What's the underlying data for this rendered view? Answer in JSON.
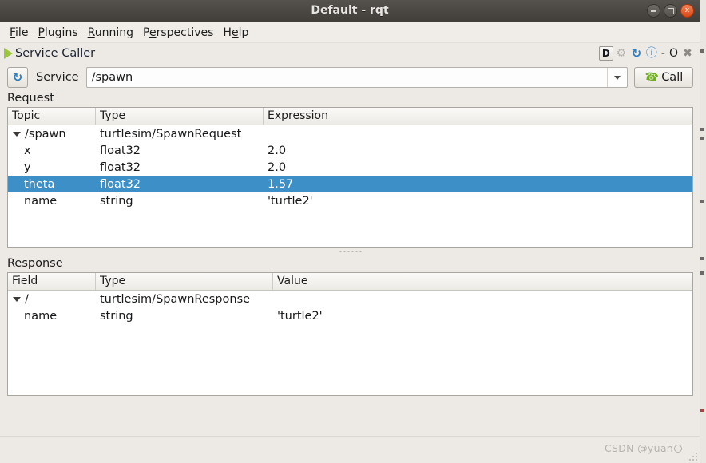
{
  "window": {
    "title": "Default - rqt",
    "buttons": [
      {
        "name": "minimize",
        "glyph": "minimize-icon"
      },
      {
        "name": "maximize",
        "glyph": "maximize-icon"
      },
      {
        "name": "close",
        "glyph": "close-icon",
        "label": "x",
        "color": "#dd4814"
      }
    ]
  },
  "menubar": {
    "items": [
      {
        "label": "File",
        "accel": "F",
        "rest": "ile"
      },
      {
        "label": "Plugins",
        "accel": "P",
        "rest": "lugins"
      },
      {
        "label": "Running",
        "accel": "R",
        "rest": "unning"
      },
      {
        "label": "Perspectives",
        "accel_pre": "P",
        "accel": "e",
        "rest": "rspectives"
      },
      {
        "label": "Help",
        "accel_pre": "H",
        "accel": "e",
        "rest": "lp"
      }
    ]
  },
  "plugin": {
    "title": "Service Caller",
    "play_icon": "play-triangle-icon",
    "actions": [
      {
        "name": "dock-detach-button",
        "label": "D",
        "icon": "letter-d-icon"
      },
      {
        "name": "settings-button",
        "label": "⚙",
        "icon": "gear-icon"
      },
      {
        "name": "reload-button",
        "label": "↻",
        "icon": "reload-icon"
      },
      {
        "name": "help-button",
        "label": "?",
        "icon": "question-mark-icon"
      },
      {
        "name": "minimize-dock-button",
        "label": "-",
        "icon": "dash-icon"
      },
      {
        "name": "maximize-dock-button",
        "label": "O",
        "icon": "circle-icon"
      },
      {
        "name": "close-dock-button",
        "label": "✖",
        "icon": "close-x-icon"
      }
    ]
  },
  "service_row": {
    "refresh_icon": "refresh-icon",
    "label": "Service",
    "value": "/spawn",
    "placeholder": "/spawn",
    "call_button": "Call",
    "call_icon": "phone-icon"
  },
  "request": {
    "section_label": "Request",
    "columns": [
      "Topic",
      "Type",
      "Expression"
    ],
    "rows": [
      {
        "name": "/spawn",
        "type": "turtlesim/SpawnRequest",
        "value": "",
        "depth": 0,
        "expanded": true,
        "selected": false
      },
      {
        "name": "x",
        "type": "float32",
        "value": "2.0",
        "depth": 1,
        "expanded": false,
        "selected": false
      },
      {
        "name": "y",
        "type": "float32",
        "value": "2.0",
        "depth": 1,
        "expanded": false,
        "selected": false
      },
      {
        "name": "theta",
        "type": "float32",
        "value": "1.57",
        "depth": 1,
        "expanded": false,
        "selected": true
      },
      {
        "name": "name",
        "type": "string",
        "value": "'turtle2'",
        "depth": 1,
        "expanded": false,
        "selected": false
      }
    ]
  },
  "response": {
    "section_label": "Response",
    "columns": [
      "Field",
      "Type",
      "Value"
    ],
    "rows": [
      {
        "name": "/",
        "type": "turtlesim/SpawnResponse",
        "value": "",
        "depth": 0,
        "expanded": true,
        "selected": false
      },
      {
        "name": "name",
        "type": "string",
        "value": "'turtle2'",
        "depth": 1,
        "expanded": false,
        "selected": false
      }
    ]
  },
  "statusbar": {
    "watermark": "CSDN @yuan"
  },
  "colors": {
    "selection": "#3d8fc7",
    "titlebar": "#4a4743",
    "close_button": "#dd4814",
    "accent_green": "#9dc43f",
    "panel": "#edeae5"
  }
}
